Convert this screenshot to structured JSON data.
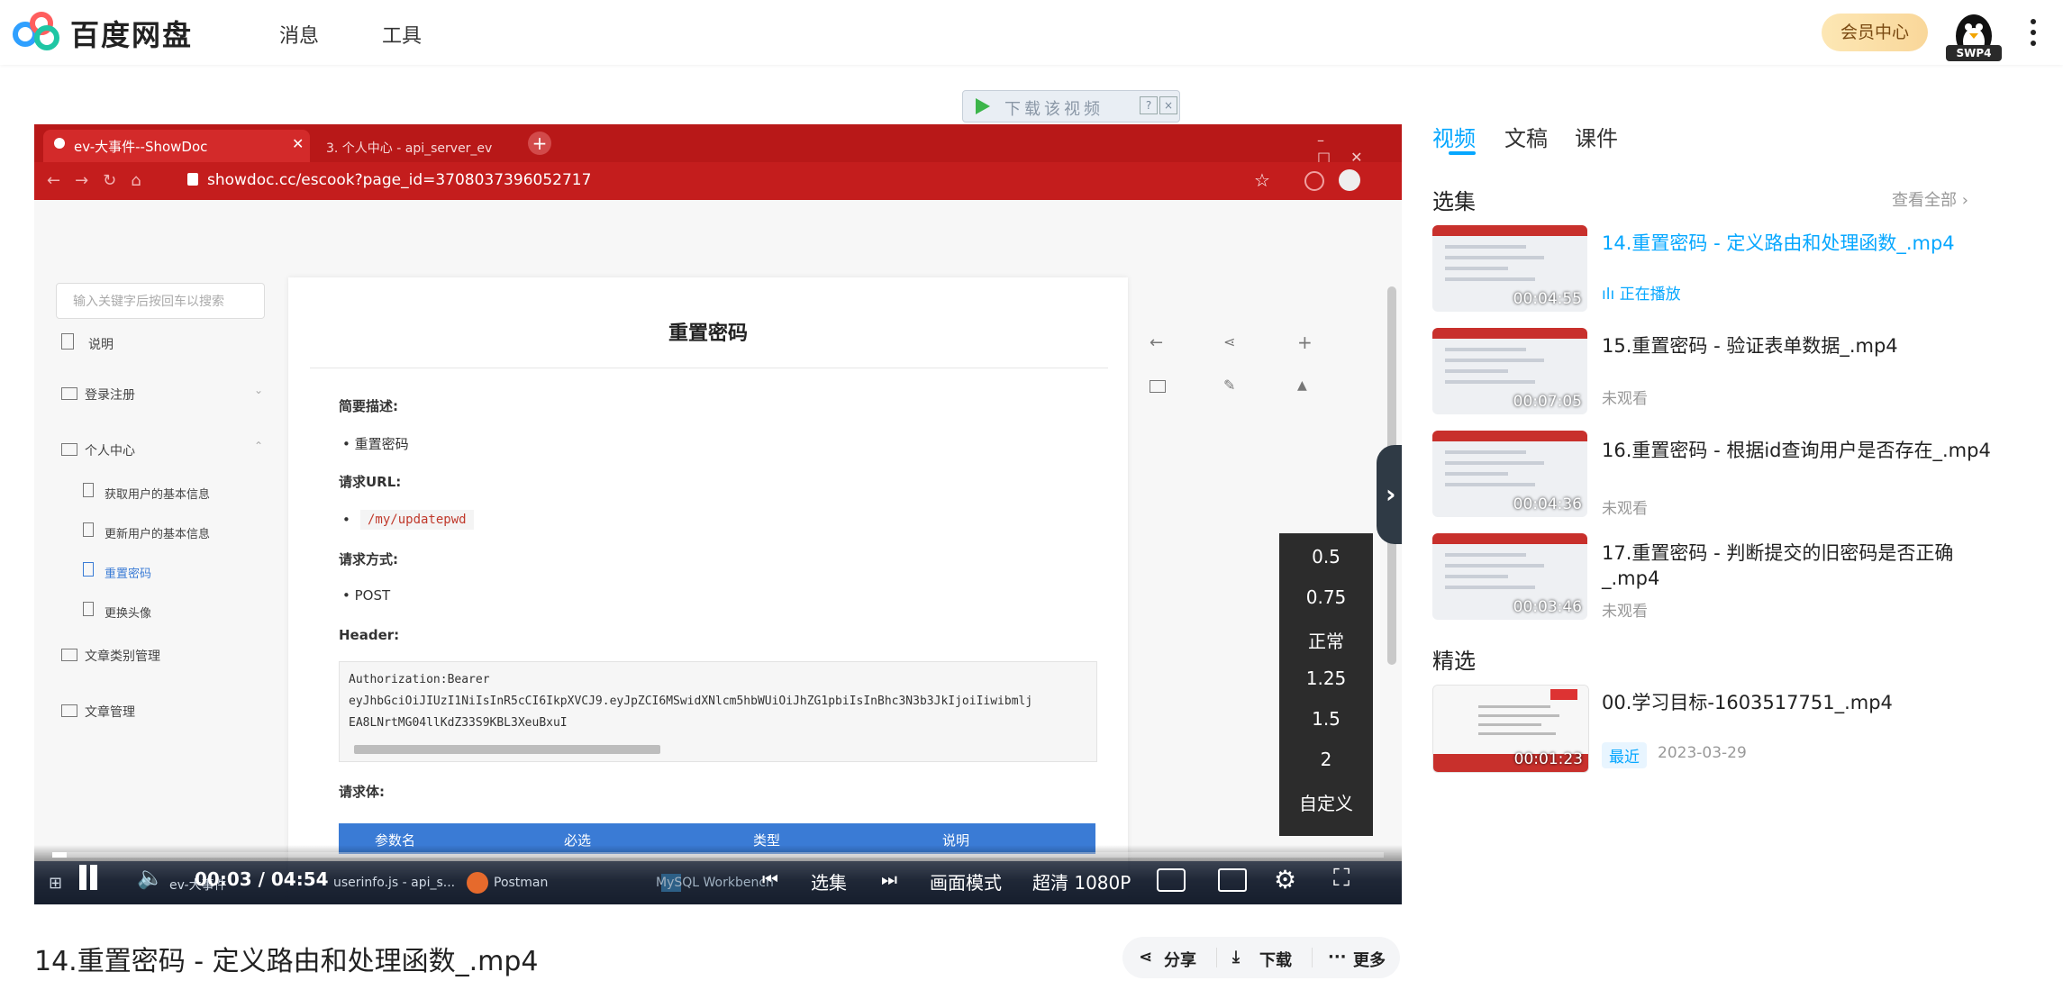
{
  "header": {
    "brand": "百度网盘",
    "nav": [
      "消息",
      "工具"
    ],
    "vip_label": "会员中心",
    "avatar_badge": "SWP4"
  },
  "overlay": {
    "download_label": "下载该视频"
  },
  "video_frame": {
    "browser_tabs": [
      "ev-大事件--ShowDoc",
      "3. 个人中心 - api_server_ev"
    ],
    "url": "showdoc.cc/escook?page_id=3708037396052717",
    "search_placeholder": "输入关键字后按回车以搜索",
    "sidebar": {
      "intro": "说明",
      "groups": [
        "登录注册",
        "个人中心",
        "文章类别管理",
        "文章管理"
      ],
      "sub_items": [
        "获取用户的基本信息",
        "更新用户的基本信息",
        "重置密码",
        "更换头像"
      ]
    },
    "doc": {
      "title": "重置密码",
      "desc_label": "简要描述:",
      "desc_item": "重置密码",
      "url_label": "请求URL:",
      "url_value": "/my/updatepwd",
      "method_label": "请求方式:",
      "method_value": "POST",
      "header_label": "Header:",
      "code_lines": [
        "Authorization:Bearer",
        "eyJhbGciOiJIUzI1NiIsInR5cCI6IkpXVCJ9.eyJpZCI6MSwidXNlcm5hbWUiOiJhZG1pbiIsInBhc3N3b3JkIjoiIiwibmlj",
        "EA8LNrtMG04llKdZ33S9KBL3XeuBxuI"
      ],
      "body_label": "请求体:",
      "table_headers": [
        "参数名",
        "必选",
        "类型",
        "说明"
      ]
    },
    "speed_options": [
      "0.5",
      "0.75",
      "正常",
      "1.25",
      "1.5",
      "2",
      "自定义"
    ],
    "taskbar_apps": [
      "ev-大事件",
      "userinfo.js - api_s...",
      "Postman",
      "MySQL Workbench"
    ]
  },
  "player": {
    "time": "00:03 / 04:54",
    "episodes_label": "选集",
    "picture_mode": "画面模式",
    "quality": "超清 1080P",
    "progress_fraction": 0.011
  },
  "video_title": "14.重置密码 - 定义路由和处理函数_.mp4",
  "actions": {
    "share": "分享",
    "download": "下载",
    "more": "更多"
  },
  "right_panel": {
    "tabs": [
      "视频",
      "文稿",
      "课件"
    ],
    "episodes_header": "选集",
    "see_all": "查看全部",
    "episodes": [
      {
        "title": "14.重置密码 - 定义路由和处理函数_.mp4",
        "duration": "00:04:55",
        "status": "正在播放"
      },
      {
        "title": "15.重置密码 - 验证表单数据_.mp4",
        "duration": "00:07:05",
        "status": "未观看"
      },
      {
        "title": "16.重置密码 - 根据id查询用户是否存在_.mp4",
        "duration": "00:04:36",
        "status": "未观看"
      },
      {
        "title": "17.重置密码 - 判断提交的旧密码是否正确_.mp4",
        "duration": "00:03:46",
        "status": "未观看"
      }
    ],
    "featured_header": "精选",
    "featured": {
      "title": "00.学习目标-1603517751_.mp4",
      "duration": "00:01:23",
      "tag": "最近",
      "date": "2023-03-29"
    }
  },
  "colors": {
    "accent": "#06a7ff",
    "browser_red": "#b81818"
  }
}
